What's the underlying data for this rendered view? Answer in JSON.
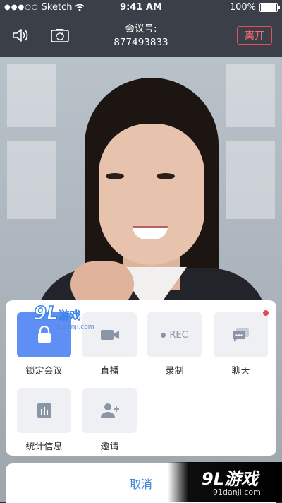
{
  "status_bar": {
    "carrier": "Sketch",
    "time": "9:41 AM",
    "battery": "100%"
  },
  "header": {
    "meeting_label": "会议号:",
    "meeting_number": "877493833",
    "leave_label": "离开",
    "icons": [
      "speaker-icon",
      "camera-switch-icon"
    ],
    "leave_color": "#e0505c"
  },
  "action_sheet": {
    "items": [
      {
        "label": "锁定会议",
        "icon": "lock-icon",
        "active": true
      },
      {
        "label": "直播",
        "icon": "video-camera-icon",
        "active": false
      },
      {
        "label": "录制",
        "icon": "rec-icon",
        "icon_text": "REC",
        "active": false
      },
      {
        "label": "聊天",
        "icon": "chat-icon",
        "active": false,
        "badge": true
      },
      {
        "label": "统计信息",
        "icon": "bar-chart-icon",
        "active": false
      },
      {
        "label": "邀请",
        "icon": "add-user-icon",
        "active": false
      }
    ],
    "active_color": "#5f8ff5"
  },
  "cancel_label": "取消",
  "watermark": {
    "logo_num": "9L",
    "logo_text": "游戏",
    "site": "91danji.com"
  }
}
